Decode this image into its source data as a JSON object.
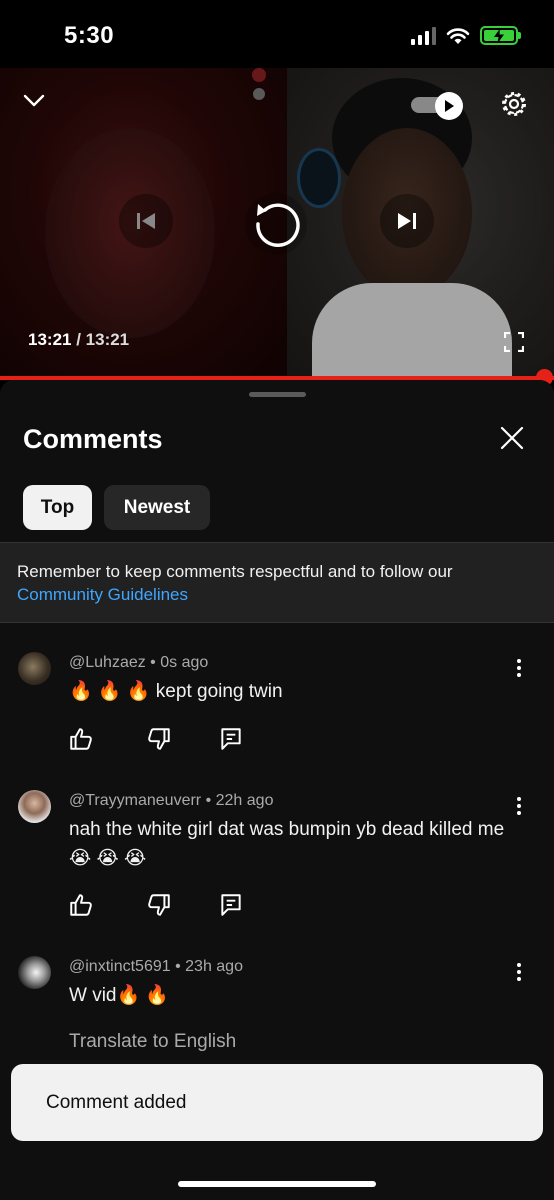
{
  "status_bar": {
    "time": "5:30"
  },
  "player": {
    "current_time": "13:21",
    "separator": " / ",
    "duration": "13:21",
    "progress": 1.0
  },
  "comments_panel": {
    "title": "Comments",
    "tabs": [
      {
        "label": "Top",
        "selected": true
      },
      {
        "label": "Newest",
        "selected": false
      }
    ],
    "notice_text": "Remember to keep comments respectful and to follow our ",
    "notice_link": "Community Guidelines"
  },
  "comments": [
    {
      "author": "@Luhzaez",
      "time": "0s ago",
      "text": "🔥 🔥 🔥 kept going twin"
    },
    {
      "author": "@Trayymaneuverr",
      "time": "22h ago",
      "text": "nah the white girl dat was bumpin yb dead killed me😭 😭 😭"
    },
    {
      "author": "@inxtinct5691",
      "time": "23h ago",
      "text": "W vid🔥 🔥",
      "translate_label": "Translate to English"
    }
  ],
  "meta_separator": " • ",
  "toast": {
    "message": "Comment added"
  },
  "colors": {
    "accent_red": "#e62117",
    "link_blue": "#3ea6ff",
    "battery_green": "#38d13a"
  }
}
